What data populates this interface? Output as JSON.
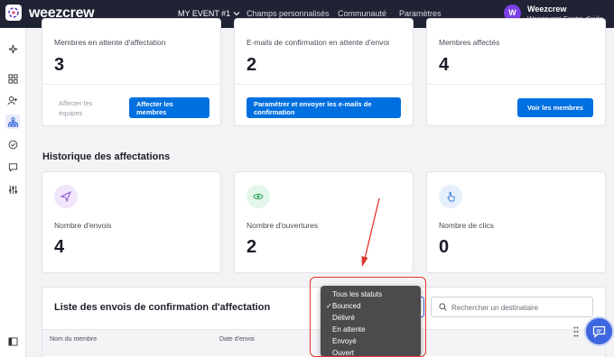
{
  "topbar": {
    "brand": "weezcrew",
    "event_label": "MY EVENT #1",
    "nav": [
      "Champs personnalisés",
      "Communauté",
      "Paramètres"
    ],
    "user": {
      "initial": "W",
      "name": "Weezcrew",
      "org": "Weezevent Centre d'aide",
      "avatar_color": "#7b3fe4"
    }
  },
  "sidebar": {
    "icons": [
      "sparkle-icon",
      "dashboard-icon",
      "add-user-icon",
      "org-chart-icon",
      "check-circle-icon",
      "chat-icon",
      "sliders-icon",
      "collapse-panel-icon"
    ],
    "active": "org-chart-icon"
  },
  "top_cards": [
    {
      "label": "Membres en attente d'affectation",
      "value": "3",
      "actions": {
        "muted": "Affecter les équipes",
        "primary": "Affecter les membres"
      }
    },
    {
      "label": "E-mails de confirmation en attente d'envoi",
      "value": "2",
      "actions": {
        "primary": "Paramétrer et envoyer les e-mails de confirmation"
      }
    },
    {
      "label": "Membres affectés",
      "value": "4",
      "actions": {
        "primary": "Voir les membres"
      }
    }
  ],
  "history": {
    "title": "Historique des affectations",
    "cards": [
      {
        "icon": "send-icon",
        "label": "Nombre d'envois",
        "value": "4",
        "circle_color": "#f1e6fb",
        "icon_color": "#8a4fd0"
      },
      {
        "icon": "eye-icon",
        "label": "Nombre d'ouvertures",
        "value": "2",
        "circle_color": "#e3f6ea",
        "icon_color": "#2e9d5a"
      },
      {
        "icon": "click-icon",
        "label": "Nombre de clics",
        "value": "0",
        "circle_color": "#e6f0fd",
        "icon_color": "#3a7ad8"
      }
    ]
  },
  "list": {
    "title": "Liste des envois de confirmation d'affectation",
    "search_placeholder": "Rechercher un destinataire",
    "columns": [
      "Nom du membre",
      "Date d'envoi"
    ]
  },
  "status_dropdown": {
    "options": [
      "Tous les statuts",
      "Bounced",
      "Délivré",
      "En attente",
      "Envoyé",
      "Ouvert"
    ],
    "selected": "Bounced",
    "check_mark": "✓"
  },
  "colors": {
    "primary": "#0070e0",
    "topbar": "#1f2333",
    "annotation": "#e0362b",
    "chat": "#3d66e0"
  }
}
